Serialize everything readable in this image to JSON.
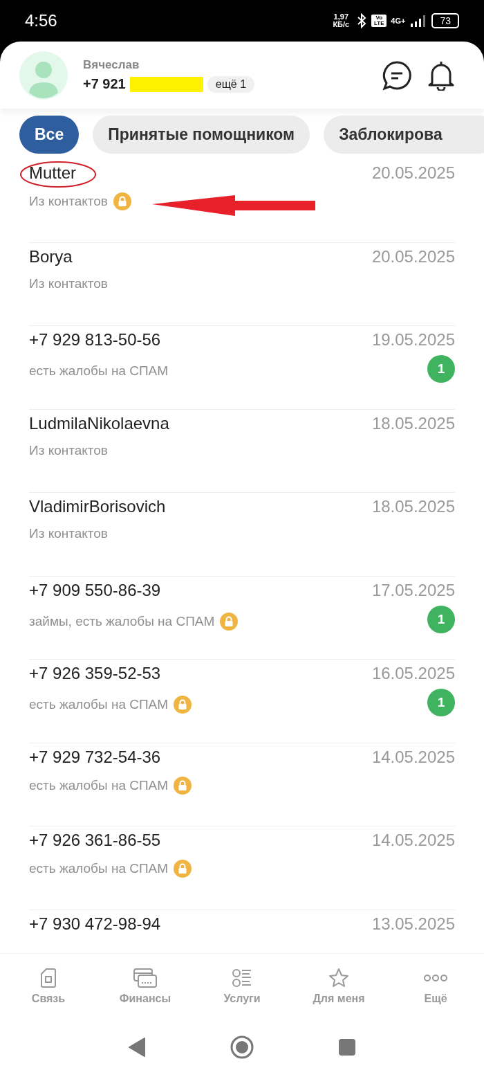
{
  "status_bar": {
    "time": "4:56",
    "speed": "1,97 КБ/с",
    "volte": "Vo LTE",
    "network": "4G+",
    "battery": "73"
  },
  "header": {
    "name": "Вячеслав",
    "phone": "+7 921",
    "phone_redacted": true,
    "more": "ещё 1"
  },
  "chips": [
    {
      "label": "Все",
      "selected": true
    },
    {
      "label": "Принятые помощником",
      "selected": false
    },
    {
      "label": "Заблокирова",
      "selected": false
    }
  ],
  "calls": [
    {
      "name": "Mutter",
      "date": "20.05.2025",
      "subtitle": "Из контактов",
      "locked": true,
      "highlighted": true
    },
    {
      "name": "Borya",
      "date": "20.05.2025",
      "subtitle": "Из контактов"
    },
    {
      "name": "+7 929 813-50-56",
      "date": "19.05.2025",
      "subtitle": "есть жалобы на СПАМ",
      "badge": "1"
    },
    {
      "name": "LudmilaNikolaevna",
      "date": "18.05.2025",
      "subtitle": "Из контактов"
    },
    {
      "name": "VladimirBorisovich",
      "date": "18.05.2025",
      "subtitle": "Из контактов"
    },
    {
      "name": "+7 909 550-86-39",
      "date": "17.05.2025",
      "subtitle": "займы, есть жалобы на СПАМ",
      "locked": true,
      "badge": "1"
    },
    {
      "name": "+7 926 359-52-53",
      "date": "16.05.2025",
      "subtitle": "есть жалобы на СПАМ",
      "locked": true,
      "badge": "1"
    },
    {
      "name": "+7 929 732-54-36",
      "date": "14.05.2025",
      "subtitle": "есть жалобы на СПАМ",
      "locked": true
    },
    {
      "name": "+7 926 361-86-55",
      "date": "14.05.2025",
      "subtitle": "есть жалобы на СПАМ",
      "locked": true
    },
    {
      "name": "+7 930 472-98-94",
      "date": "13.05.2025"
    }
  ],
  "bottom_nav": [
    {
      "label": "Связь",
      "kind": "sim"
    },
    {
      "label": "Финансы",
      "kind": "cards"
    },
    {
      "label": "Услуги",
      "kind": "list"
    },
    {
      "label": "Для меня",
      "kind": "star"
    },
    {
      "label": "Ещё",
      "kind": "more"
    }
  ]
}
